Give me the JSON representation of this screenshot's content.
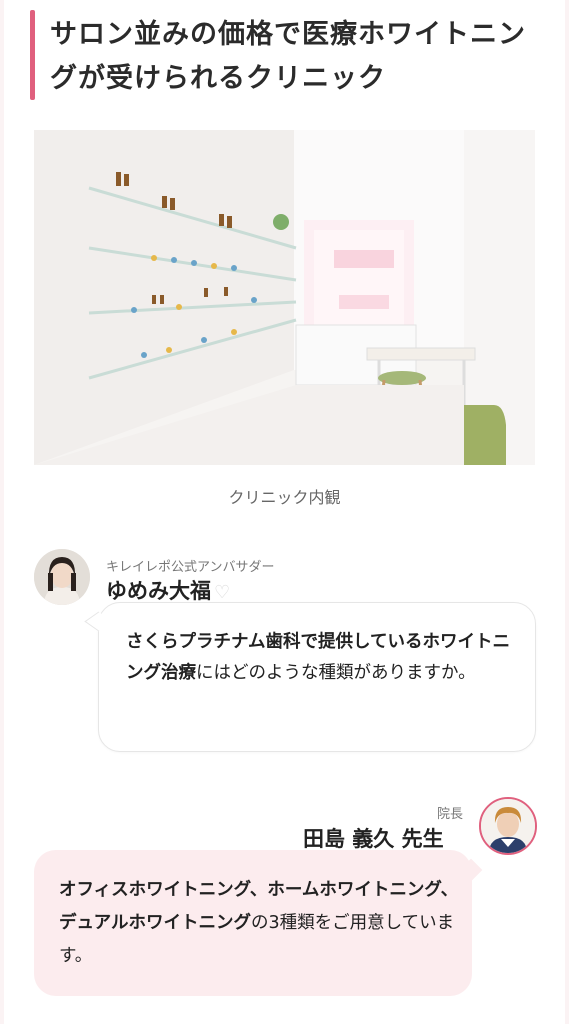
{
  "heading": {
    "title": "サロン並みの価格で医療ホワイトニングが受けられるクリニック",
    "accent_color": "#e0607e"
  },
  "photo": {
    "caption": "クリニック内観",
    "icon": "clinic-interior-photo"
  },
  "interviewer": {
    "role": "キレイレポ公式アンバサダー",
    "name": "ゆめみ大福",
    "heart": "♡",
    "question_bold": "さくらプラチナム歯科で提供しているホワイトニング治療",
    "question_rest": "にはどのような種類がありますか。"
  },
  "doctor": {
    "role": "院長",
    "name": "田島 義久 先生",
    "answer_bold": "オフィスホワイトニング、ホームホワイトニング、デュアルホワイトニング",
    "answer_rest": "の3種類をご用意しています。",
    "bubble_color": "#fcecee"
  }
}
